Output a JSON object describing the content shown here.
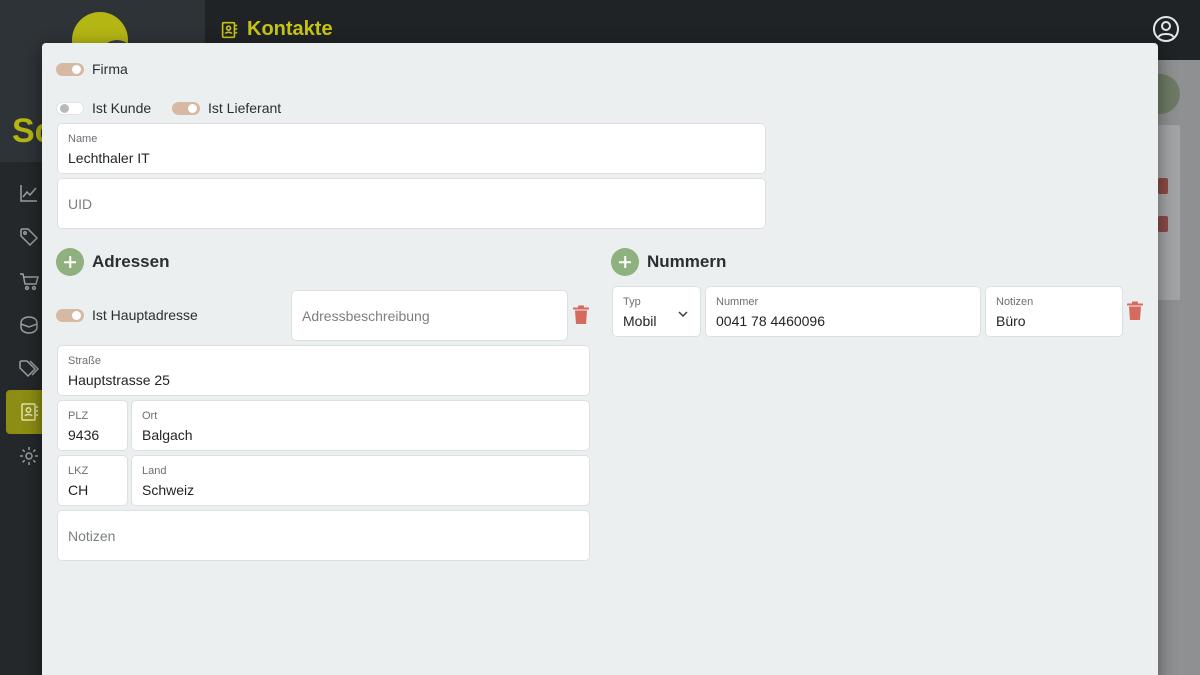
{
  "app": {
    "page_title": "Kontakte",
    "logo_text": "Sc",
    "nav_icons": [
      "chart-line-icon",
      "tag-icon",
      "cart-icon",
      "box-icon",
      "tags-icon",
      "contacts-icon",
      "settings-icon"
    ]
  },
  "form": {
    "firma_label": "Firma",
    "ist_kunde_label": "Ist Kunde",
    "ist_lieferant_label": "Ist Lieferant",
    "name_label": "Name",
    "name_value": "Lechthaler IT",
    "uid_placeholder": "UID"
  },
  "addresses": {
    "heading": "Adressen",
    "main_address_label": "Ist Hauptadresse",
    "description_placeholder": "Adressbeschreibung",
    "street_label": "Straße",
    "street_value": "Hauptstrasse 25",
    "zip_label": "PLZ",
    "zip_value": "9436",
    "city_label": "Ort",
    "city_value": "Balgach",
    "country_code_label": "LKZ",
    "country_code_value": "CH",
    "country_label": "Land",
    "country_value": "Schweiz",
    "notes_placeholder": "Notizen"
  },
  "numbers": {
    "heading": "Nummern",
    "type_label": "Typ",
    "type_value": "Mobil",
    "number_label": "Nummer",
    "number_value": "0041 78 4460096",
    "notes_label": "Notizen",
    "notes_value": "Büro"
  },
  "colors": {
    "accent": "#b4b614",
    "toggle_on": "#d7b9a3",
    "add_button": "#8fb07f",
    "delete": "#d66a5e"
  }
}
